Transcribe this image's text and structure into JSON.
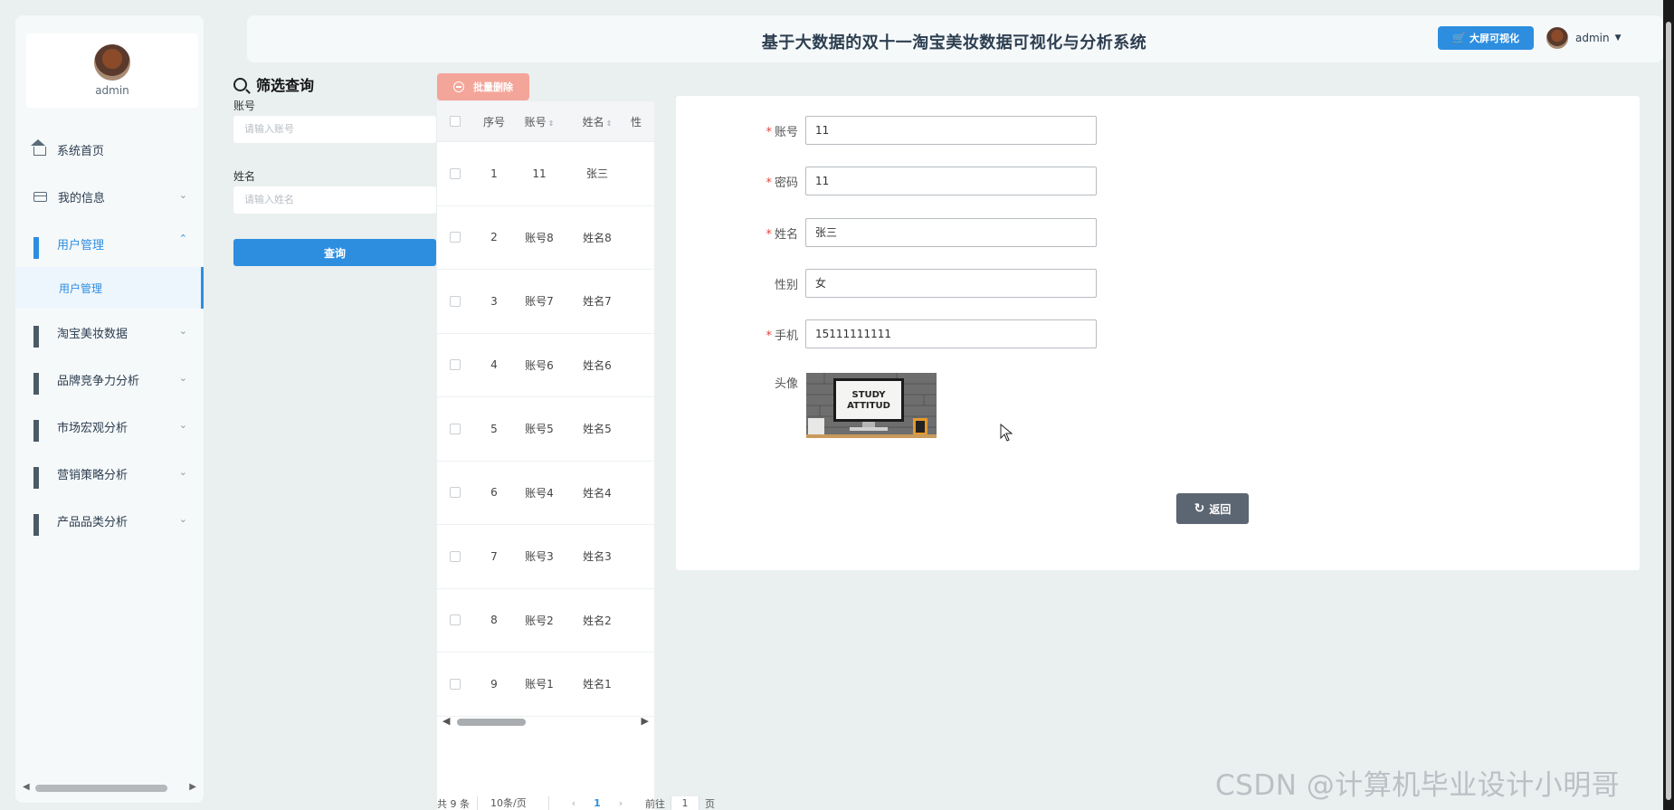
{
  "header": {
    "title": "基于大数据的双十一淘宝美妆数据可视化与分析系统",
    "big_screen_button": "大屏可视化",
    "username": "admin"
  },
  "sidebar": {
    "profile_name": "admin",
    "items": [
      {
        "label": "系统首页",
        "icon": "home-icon"
      },
      {
        "label": "我的信息",
        "icon": "card-icon"
      },
      {
        "label": "用户管理",
        "icon": "grid-icon",
        "expanded": true
      },
      {
        "label": "淘宝美妆数据",
        "icon": "grid-icon"
      },
      {
        "label": "品牌竞争力分析",
        "icon": "grid-icon"
      },
      {
        "label": "市场宏观分析",
        "icon": "grid-icon"
      },
      {
        "label": "营销策略分析",
        "icon": "grid-icon"
      },
      {
        "label": "产品品类分析",
        "icon": "grid-icon"
      }
    ],
    "sub_item": "用户管理"
  },
  "filter": {
    "title": "筛选查询",
    "account_label": "账号",
    "account_placeholder": "请输入账号",
    "name_label": "姓名",
    "name_placeholder": "请输入姓名",
    "query_button": "查询"
  },
  "table": {
    "batch_delete": "批量删除",
    "headers": {
      "seq": "序号",
      "account": "账号",
      "name": "姓名",
      "gender": "性"
    },
    "rows": [
      {
        "seq": "1",
        "account": "11",
        "name": "张三"
      },
      {
        "seq": "2",
        "account": "账号8",
        "name": "姓名8"
      },
      {
        "seq": "3",
        "account": "账号7",
        "name": "姓名7"
      },
      {
        "seq": "4",
        "account": "账号6",
        "name": "姓名6"
      },
      {
        "seq": "5",
        "account": "账号5",
        "name": "姓名5"
      },
      {
        "seq": "6",
        "account": "账号4",
        "name": "姓名4"
      },
      {
        "seq": "7",
        "account": "账号3",
        "name": "姓名3"
      },
      {
        "seq": "8",
        "account": "账号2",
        "name": "姓名2"
      },
      {
        "seq": "9",
        "account": "账号1",
        "name": "姓名1"
      }
    ]
  },
  "pager": {
    "total": "共 9 条",
    "page_size": "10条/页",
    "current_page": "1",
    "goto_label": "前往",
    "goto_value": "1",
    "page_suffix": "页"
  },
  "form": {
    "fields": [
      {
        "label": "账号",
        "value": "11",
        "required": true
      },
      {
        "label": "密码",
        "value": "11",
        "required": true
      },
      {
        "label": "姓名",
        "value": "张三",
        "required": true
      },
      {
        "label": "性别",
        "value": "女",
        "required": false
      },
      {
        "label": "手机",
        "value": "15111111111",
        "required": true
      }
    ],
    "avatar_label": "头像",
    "avatar_image_text": "STUDY ATTITUD",
    "required_mark": "*",
    "back_button": "返回"
  },
  "watermark": "CSDN @计算机毕业设计小明哥",
  "colors": {
    "primary": "#2d8ee0",
    "danger_light": "#f4a59a",
    "back_button": "#5b6672",
    "background": "#eaeff0"
  }
}
